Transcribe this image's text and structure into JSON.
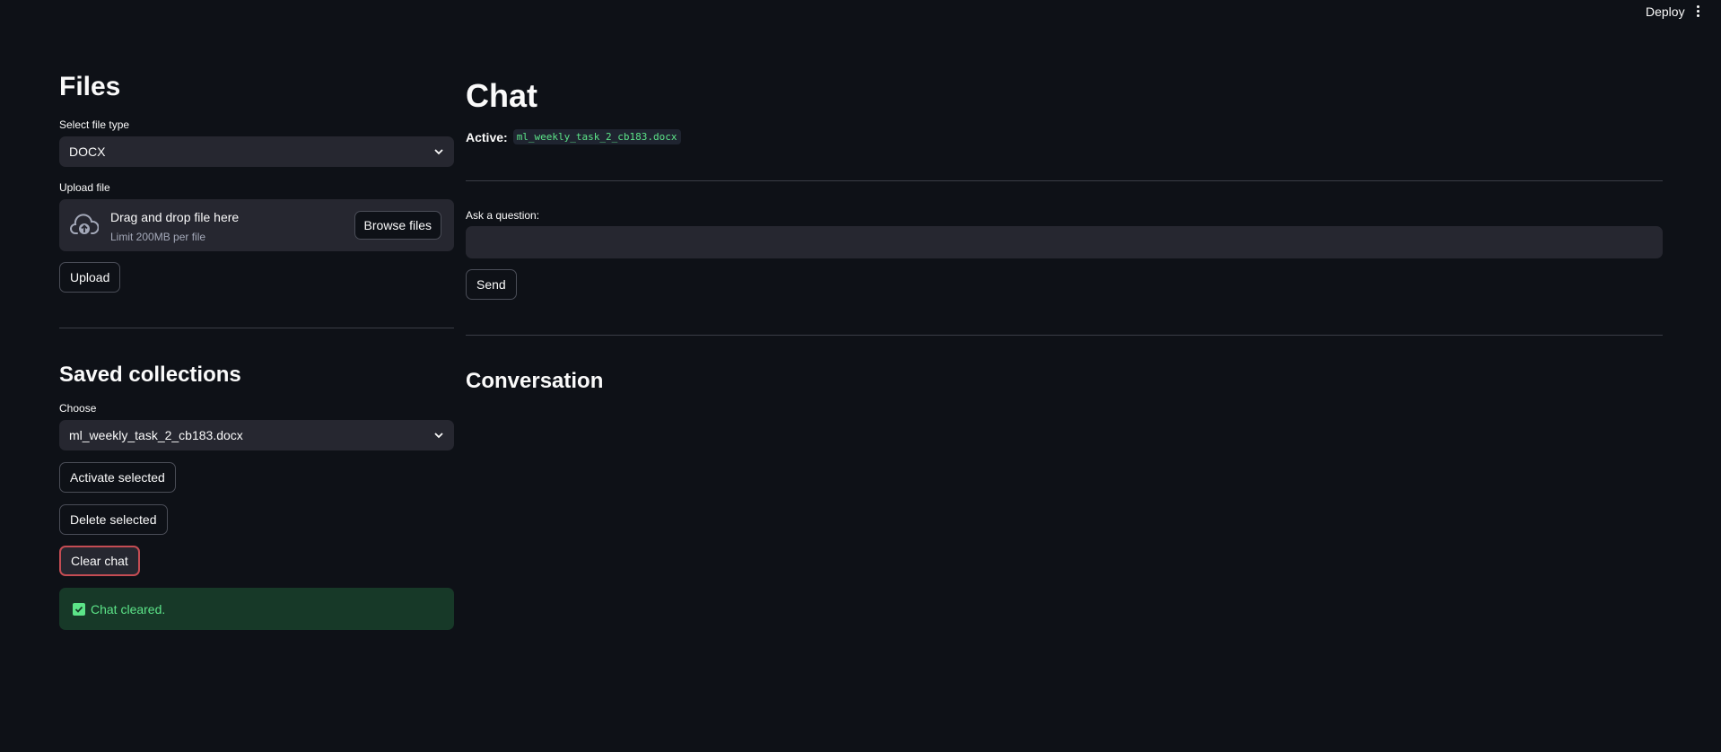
{
  "topbar": {
    "deploy_label": "Deploy"
  },
  "left": {
    "files_title": "Files",
    "file_type_label": "Select file type",
    "file_type_value": "DOCX",
    "upload_label": "Upload file",
    "dropzone_main": "Drag and drop file here",
    "dropzone_sub": "Limit 200MB per file",
    "browse_label": "Browse files",
    "upload_button": "Upload",
    "saved_title": "Saved collections",
    "choose_label": "Choose",
    "choose_value": "ml_weekly_task_2_cb183.docx",
    "activate_button": "Activate selected",
    "delete_button": "Delete selected",
    "clear_button": "Clear chat",
    "success_message": "Chat cleared."
  },
  "right": {
    "chat_title": "Chat",
    "active_label": "Active:",
    "active_file": "ml_weekly_task_2_cb183.docx",
    "question_label": "Ask a question:",
    "question_value": "",
    "send_button": "Send",
    "conversation_title": "Conversation"
  },
  "colors": {
    "background": "#0e1117",
    "input_bg": "#262730",
    "success_bg": "#173928",
    "success_text": "#5ce488",
    "focus_border": "#c44c53"
  },
  "icons": [
    "kebab-menu-icon",
    "chevron-down-icon",
    "cloud-upload-icon",
    "checkbox-icon"
  ]
}
